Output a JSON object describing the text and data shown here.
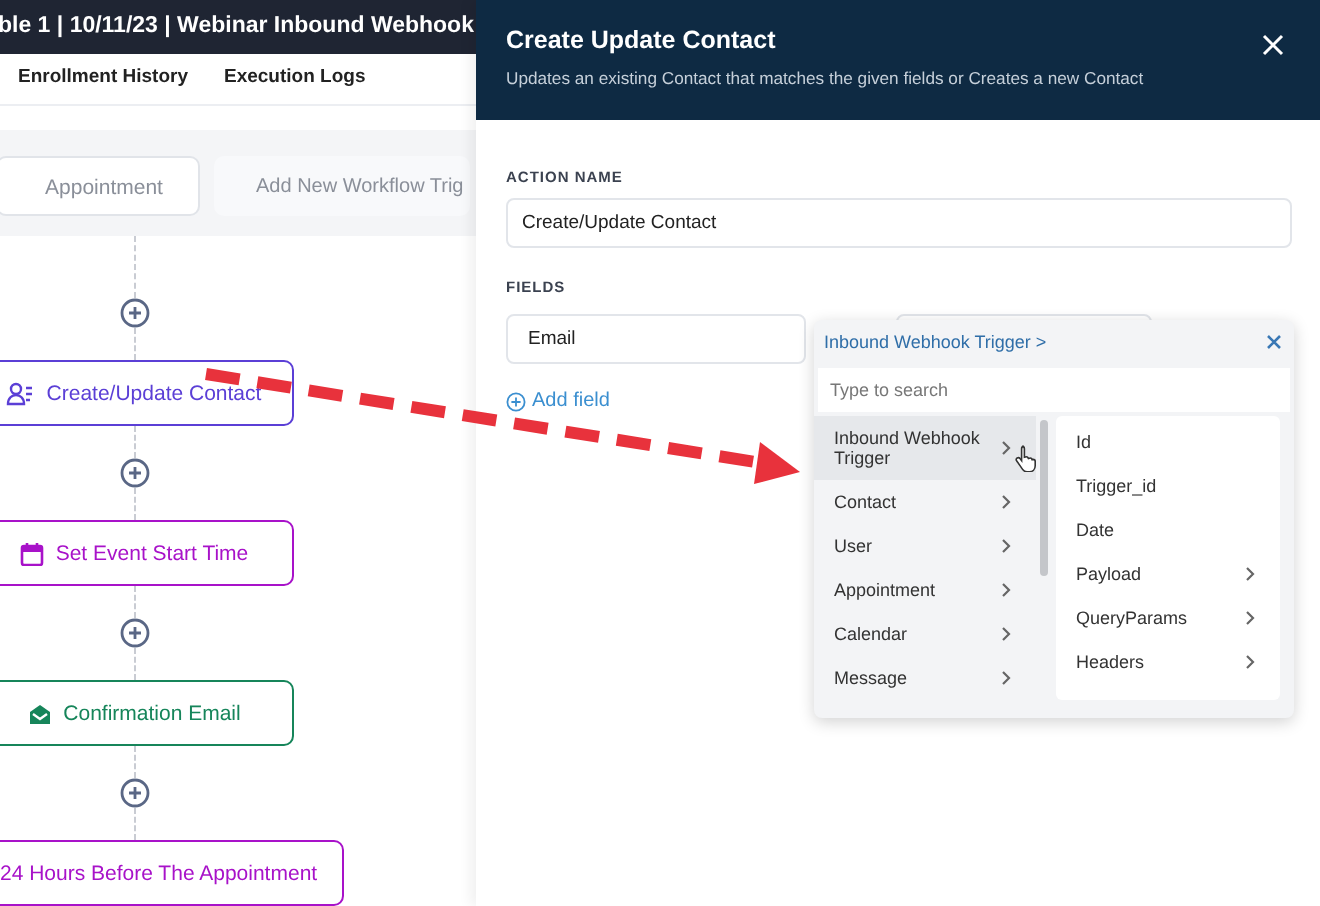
{
  "header": {
    "title": "ble 1 | 10/11/23 | Webinar Inbound Webhook"
  },
  "tabs": [
    {
      "label": "Enrollment History",
      "selected": false
    },
    {
      "label": "Execution Logs",
      "selected": false
    }
  ],
  "triggers": [
    {
      "label": "Appointment",
      "kind": "trigger"
    },
    {
      "label": "Add New Workflow Trig",
      "kind": "add"
    }
  ],
  "steps": [
    {
      "label": "Create/Update Contact",
      "kind": "contact",
      "color": "#5b3fd6"
    },
    {
      "label": "Set Event Start Time",
      "kind": "calendar",
      "color": "#a812c9"
    },
    {
      "label": "Confirmation Email",
      "kind": "email",
      "color": "#16855a"
    },
    {
      "label": "24 Hours Before The Appointment",
      "kind": "wait",
      "color": "#a812c9"
    }
  ],
  "panel": {
    "title": "Create Update Contact",
    "subtitle": "Updates an existing Contact that matches the given fields or Creates a new Contact",
    "action_name_label": "ACTION NAME",
    "action_name": "Create/Update Contact",
    "fields_label": "FIELDS",
    "field_value": "Email",
    "add_field": "Add field"
  },
  "picker": {
    "breadcrumb": "Inbound Webhook Trigger >",
    "search_placeholder": "Type to search",
    "categories": [
      {
        "label": "Inbound Webhook Trigger",
        "selected": true
      },
      {
        "label": "Contact",
        "selected": false
      },
      {
        "label": "User",
        "selected": false
      },
      {
        "label": "Appointment",
        "selected": false
      },
      {
        "label": "Calendar",
        "selected": false
      },
      {
        "label": "Message",
        "selected": false
      }
    ],
    "options": [
      {
        "label": "Id",
        "has_children": false
      },
      {
        "label": "Trigger_id",
        "has_children": false
      },
      {
        "label": "Date",
        "has_children": false
      },
      {
        "label": "Payload",
        "has_children": true
      },
      {
        "label": "QueryParams",
        "has_children": true
      },
      {
        "label": "Headers",
        "has_children": true
      }
    ]
  }
}
